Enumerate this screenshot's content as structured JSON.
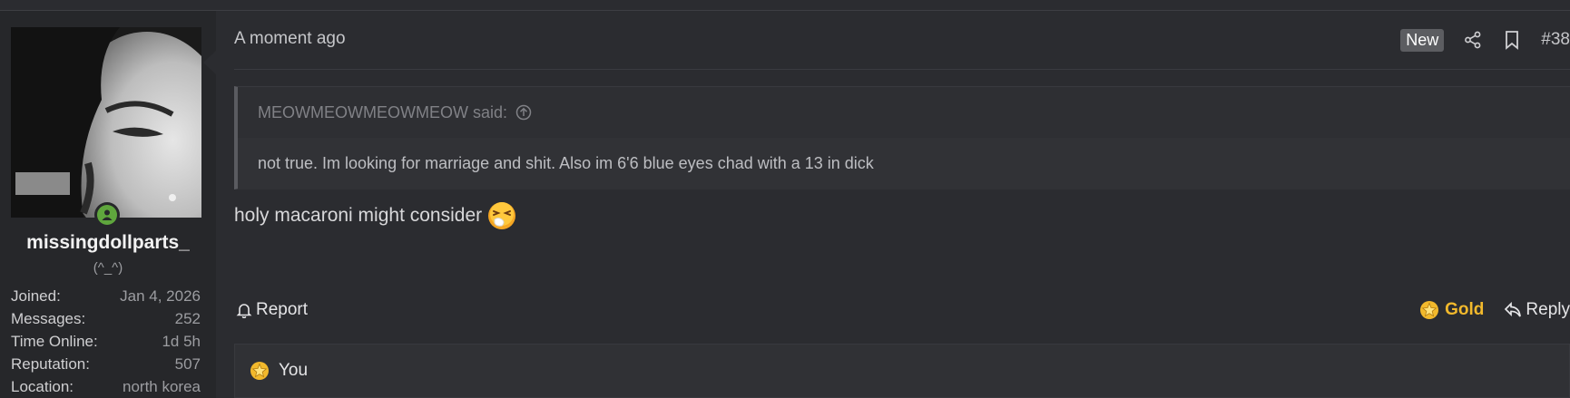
{
  "user": {
    "username": "missingdollparts_",
    "title": "(^_^)",
    "stats": [
      {
        "label": "Joined:",
        "value": "Jan 4, 2026"
      },
      {
        "label": "Messages:",
        "value": "252"
      },
      {
        "label": "Time Online:",
        "value": "1d 5h"
      },
      {
        "label": "Reputation:",
        "value": "507"
      },
      {
        "label": "Location:",
        "value": "north korea"
      }
    ]
  },
  "post": {
    "date": "A moment ago",
    "new_badge": "New",
    "number": "#38",
    "quote": {
      "author": "MEOWMEOWMEOWMEOW said:",
      "text": "not true. Im looking for marriage and shit. Also im 6'6 blue eyes chad with a 13 in dick"
    },
    "message": "holy macaroni might consider"
  },
  "actions": {
    "report": "Report",
    "gold": "Gold",
    "reply": "Reply"
  },
  "reactions": {
    "text": "You"
  },
  "colors": {
    "gold": "#f2b92c",
    "online": "#5fa63d"
  }
}
